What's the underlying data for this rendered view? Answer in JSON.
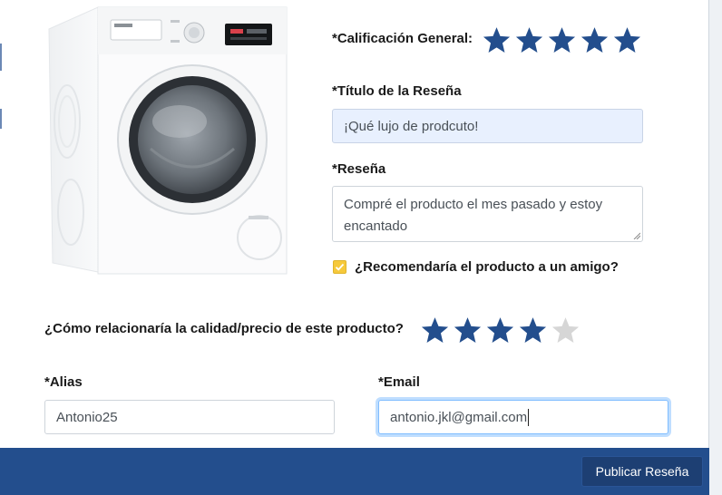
{
  "review": {
    "overall_label": "*Calificación General:",
    "overall_rating": 5,
    "title_label": "*Título de la Reseña",
    "title_value": "¡Qué lujo de prodcuto!",
    "body_label": "*Reseña",
    "body_value": "Compré el producto el mes pasado y estoy encantado",
    "recommend_label": "¿Recomendaría el producto a un amigo?",
    "recommend_checked": true,
    "value_label": "¿Cómo relacionaría la calidad/precio de este producto?",
    "value_rating": 4,
    "rating_max": 5,
    "alias_label": "*Alias",
    "alias_value": "Antonio25",
    "email_label": "*Email",
    "email_value": "antonio.jkl@gmail.com"
  },
  "footer": {
    "publish_label": "Publicar Reseña"
  },
  "colors": {
    "star_filled": "#234e8d",
    "star_empty": "#d6d6d6",
    "footer_bg": "#234e8d",
    "checkbox": "#f6c93b"
  }
}
